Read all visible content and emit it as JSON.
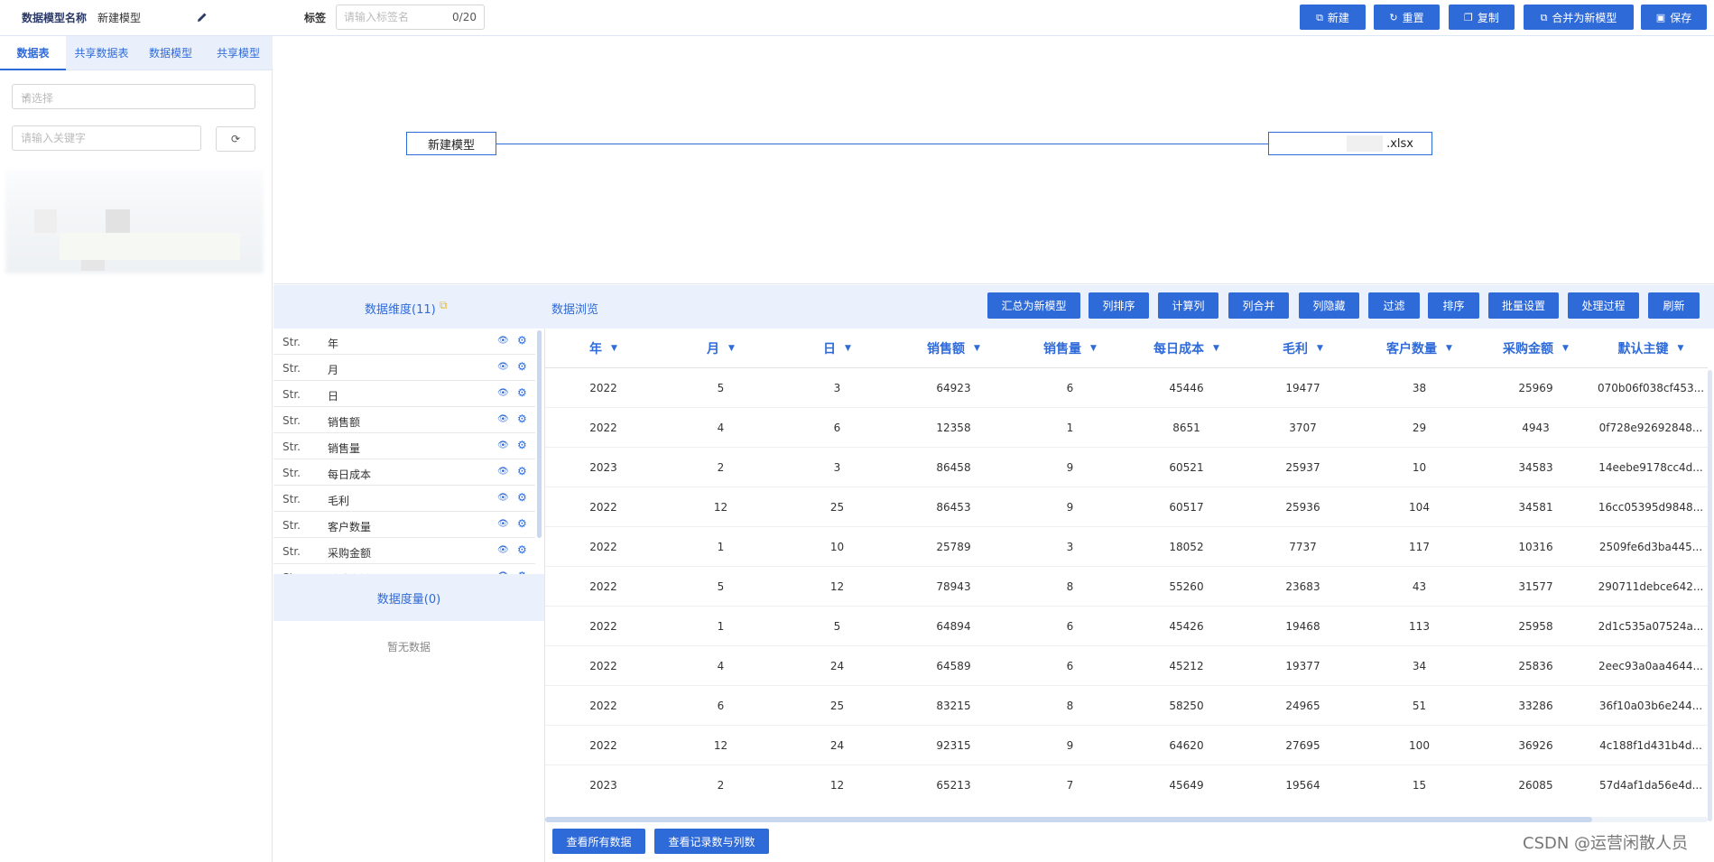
{
  "header": {
    "model_name_label": "数据模型名称",
    "model_name_value": "新建模型",
    "tag_label": "标签",
    "tag_placeholder": "请输入标签名",
    "tag_count": "0/20",
    "buttons": {
      "new": "新建",
      "reset": "重置",
      "copy": "复制",
      "merge": "合并为新模型",
      "save": "保存"
    }
  },
  "sidebar": {
    "tabs": [
      "数据表",
      "共享数据表",
      "数据模型",
      "共享模型"
    ],
    "select_placeholder": "请选择",
    "search_placeholder": "请输入关键字"
  },
  "canvas": {
    "source_node": "新建模型",
    "target_node": ".xlsx"
  },
  "panel": {
    "dimension_title": "数据维度(11)",
    "preview_title": "数据浏览",
    "measure_title": "数据度量(0)",
    "no_data": "暂无数据",
    "actions": [
      "汇总为新模型",
      "列排序",
      "计算列",
      "列合并",
      "列隐藏",
      "过滤",
      "排序",
      "批量设置",
      "处理过程",
      "刷新"
    ],
    "dimensions": [
      {
        "type": "Str.",
        "name": "年"
      },
      {
        "type": "Str.",
        "name": "月"
      },
      {
        "type": "Str.",
        "name": "日"
      },
      {
        "type": "Str.",
        "name": "销售额"
      },
      {
        "type": "Str.",
        "name": "销售量"
      },
      {
        "type": "Str.",
        "name": "每日成本"
      },
      {
        "type": "Str.",
        "name": "毛利"
      },
      {
        "type": "Str.",
        "name": "客户数量"
      },
      {
        "type": "Str.",
        "name": "采购金额"
      },
      {
        "type": "Str.",
        "name": "默认主键"
      }
    ]
  },
  "table": {
    "columns": [
      "年",
      "月",
      "日",
      "销售额",
      "销售量",
      "每日成本",
      "毛利",
      "客户数量",
      "采购金额",
      "默认主键"
    ],
    "rows": [
      [
        "2022",
        "5",
        "3",
        "64923",
        "6",
        "45446",
        "19477",
        "38",
        "25969",
        "070b06f038cf453..."
      ],
      [
        "2022",
        "4",
        "6",
        "12358",
        "1",
        "8651",
        "3707",
        "29",
        "4943",
        "0f728e92692848..."
      ],
      [
        "2023",
        "2",
        "3",
        "86458",
        "9",
        "60521",
        "25937",
        "10",
        "34583",
        "14eebe9178cc4d..."
      ],
      [
        "2022",
        "12",
        "25",
        "86453",
        "9",
        "60517",
        "25936",
        "104",
        "34581",
        "16cc05395d9848..."
      ],
      [
        "2022",
        "1",
        "10",
        "25789",
        "3",
        "18052",
        "7737",
        "117",
        "10316",
        "2509fe6d3ba445..."
      ],
      [
        "2022",
        "5",
        "12",
        "78943",
        "8",
        "55260",
        "23683",
        "43",
        "31577",
        "290711debce642..."
      ],
      [
        "2022",
        "1",
        "5",
        "64894",
        "6",
        "45426",
        "19468",
        "113",
        "25958",
        "2d1c535a07524a..."
      ],
      [
        "2022",
        "4",
        "24",
        "64589",
        "6",
        "45212",
        "19377",
        "34",
        "25836",
        "2eec93a0aa4644..."
      ],
      [
        "2022",
        "6",
        "25",
        "83215",
        "8",
        "58250",
        "24965",
        "51",
        "33286",
        "36f10a03b6e244..."
      ],
      [
        "2022",
        "12",
        "24",
        "92315",
        "9",
        "64620",
        "27695",
        "100",
        "36926",
        "4c188f1d431b4d..."
      ],
      [
        "2023",
        "2",
        "12",
        "65213",
        "7",
        "45649",
        "19564",
        "15",
        "26085",
        "57d4af1da56e4d..."
      ]
    ]
  },
  "footer": {
    "view_all": "查看所有数据",
    "view_counts": "查看记录数与列数",
    "watermark": "CSDN @运营闲散人员"
  },
  "colors": {
    "accent": "#2f6ad9",
    "band": "#eaf1fc"
  }
}
